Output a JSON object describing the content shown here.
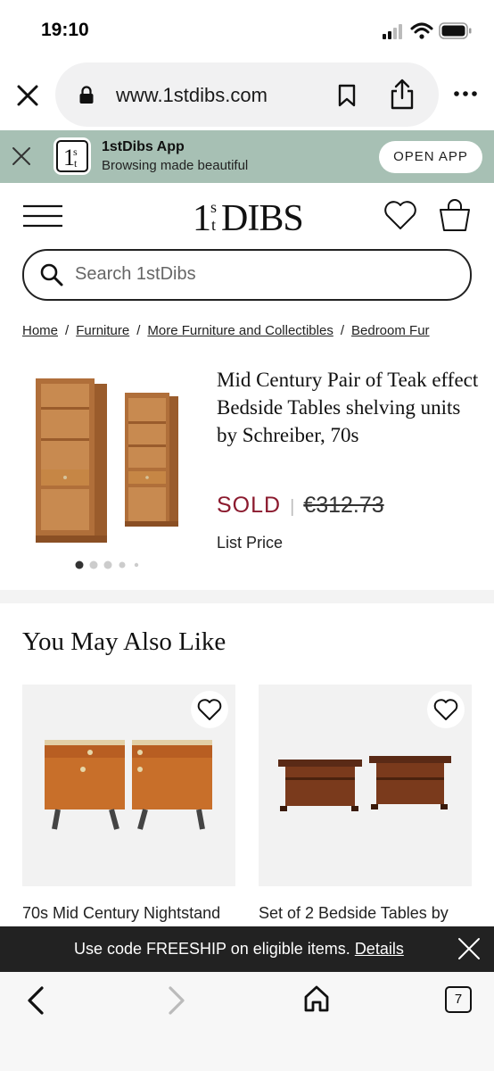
{
  "status_bar": {
    "time": "19:10"
  },
  "browser": {
    "url": "www.1stdibs.com"
  },
  "app_banner": {
    "title": "1stDibs App",
    "subtitle": "Browsing made beautiful",
    "open_label": "OPEN APP",
    "logo_text": "1st"
  },
  "header": {
    "logo": "1stDIBS"
  },
  "search": {
    "placeholder": "Search 1stDibs",
    "value": ""
  },
  "breadcrumb": {
    "items": [
      "Home",
      "Furniture",
      "More Furniture and Collectibles",
      "Bedroom Fur"
    ],
    "separator": "/"
  },
  "product": {
    "title": "Mid Century Pair of Teak effect Bedside Tables shelving units by Schreiber, 70s",
    "status": "SOLD",
    "price_separator": "|",
    "price": "€312.73",
    "price_label": "List Price",
    "image_count": 5,
    "active_image_index": 0
  },
  "recommendations": {
    "title": "You May Also Like",
    "items": [
      {
        "title": "70s Mid Century Nightstand"
      },
      {
        "title": "Set of 2 Bedside Tables by"
      }
    ]
  },
  "promo": {
    "text": "Use code FREESHIP on eligible items. ",
    "link": "Details"
  },
  "bottom_nav": {
    "tab_count": "7"
  },
  "colors": {
    "banner_bg": "#a7c0b4",
    "sold_red": "#8b1a2e",
    "promo_bg": "#222222"
  }
}
